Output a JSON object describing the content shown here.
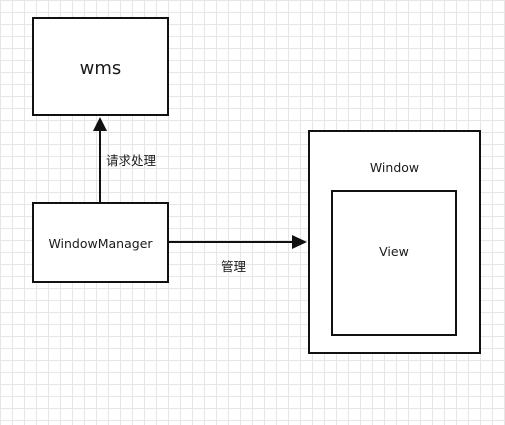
{
  "diagram": {
    "nodes": {
      "wms": {
        "label": "wms"
      },
      "window_manager": {
        "label": "WindowManager"
      },
      "window": {
        "label": "Window"
      },
      "view": {
        "label": "View"
      }
    },
    "edges": {
      "request_handling": {
        "label": "请求处理",
        "from": "WindowManager",
        "to": "wms"
      },
      "manage": {
        "label": "管理",
        "from": "WindowManager",
        "to": "Window"
      }
    },
    "colors": {
      "stroke": "#111111",
      "grid": "#e6e6e6",
      "background": "#ffffff"
    }
  }
}
